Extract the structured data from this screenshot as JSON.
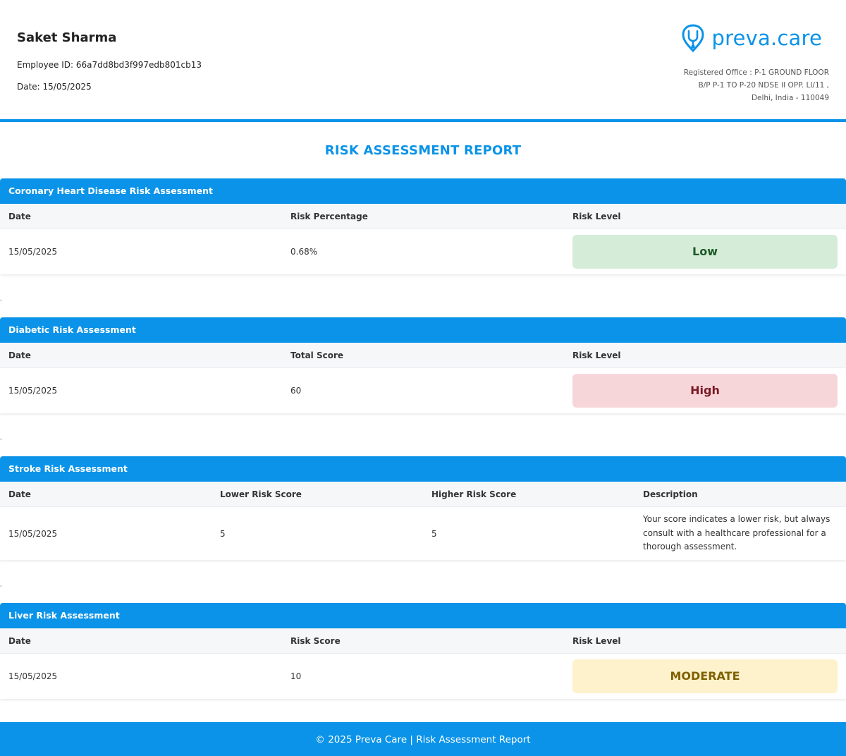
{
  "employee": {
    "name": "Saket Sharma",
    "id_line": "Employee ID: 66a7dd8bd3f997edb801cb13",
    "date_line": "Date: 15/05/2025"
  },
  "brand": {
    "logo_text": "preva.care",
    "logo_icon": "stethoscope-pin-icon",
    "color": "#0a93e8"
  },
  "office": {
    "line1": "Registered Office : P-1 GROUND FLOOR",
    "line2": "B/P P-1 TO P-20 NDSE II OPP. LI/11 ,",
    "line3": "Delhi, India - 110049"
  },
  "report_title": "RISK ASSESSMENT REPORT",
  "separator": ",",
  "sections": {
    "chd": {
      "title": "Coronary Heart Disease Risk Assessment",
      "headers": [
        "Date",
        "Risk Percentage",
        "Risk Level"
      ],
      "row": {
        "date": "15/05/2025",
        "value": "0.68%",
        "level": "Low"
      },
      "level_colors": {
        "bg": "#d4ecd8",
        "text": "#1d5a27"
      }
    },
    "diabetic": {
      "title": "Diabetic Risk Assessment",
      "headers": [
        "Date",
        "Total Score",
        "Risk Level"
      ],
      "row": {
        "date": "15/05/2025",
        "value": "60",
        "level": "High"
      },
      "level_colors": {
        "bg": "#f7d6da",
        "text": "#7a1a24"
      }
    },
    "stroke": {
      "title": "Stroke Risk Assessment",
      "headers": [
        "Date",
        "Lower Risk Score",
        "Higher Risk Score",
        "Description"
      ],
      "row": {
        "date": "15/05/2025",
        "lower": "5",
        "higher": "5",
        "description": "Your score indicates a lower risk, but always consult with a healthcare professional for a thorough assessment."
      }
    },
    "liver": {
      "title": "Liver Risk Assessment",
      "headers": [
        "Date",
        "Risk Score",
        "Risk Level"
      ],
      "row": {
        "date": "15/05/2025",
        "value": "10",
        "level": "MODERATE"
      },
      "level_colors": {
        "bg": "#fdf2cc",
        "text": "#7f6000"
      }
    }
  },
  "footer": "© 2025 Preva Care | Risk Assessment Report"
}
